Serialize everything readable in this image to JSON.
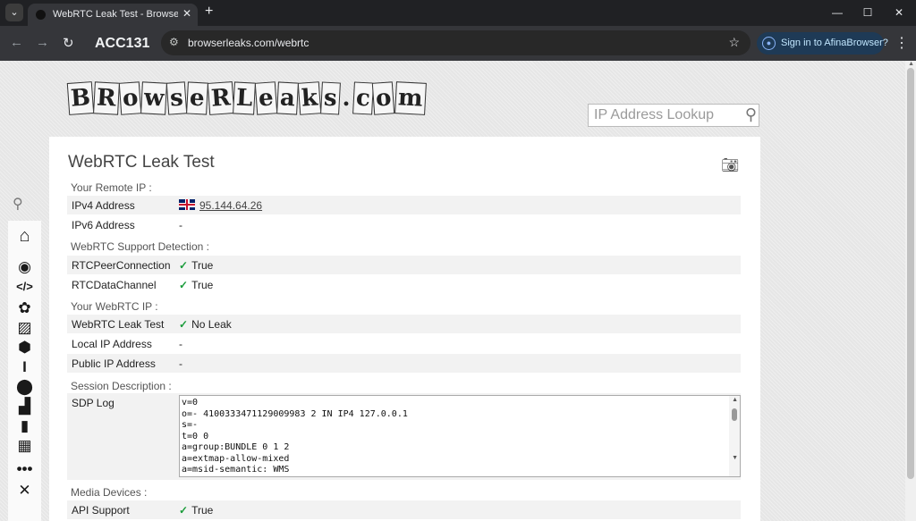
{
  "browser": {
    "tab_title": "WebRTC Leak Test - BrowserLeaks",
    "tab_close": "✕",
    "new_tab": "+",
    "profile_name": "ACC131",
    "url": "browserleaks.com/webrtc",
    "signin_label": "Sign in to AfinaBrowser?"
  },
  "site": {
    "logo_tiles": [
      "B",
      "R",
      "o",
      "w",
      "s",
      "e",
      "R",
      "L",
      "e",
      "a",
      "k",
      "s",
      ".",
      "c",
      "o",
      "m"
    ],
    "lookup_placeholder": "IP Address Lookup"
  },
  "panel": {
    "title": "WebRTC Leak Test",
    "sections": {
      "remote_ip": "Your Remote IP :",
      "support": "WebRTC Support Detection :",
      "webrtc_ip": "Your WebRTC IP :",
      "session": "Session Description :",
      "media": "Media Devices :"
    },
    "rows": {
      "ipv4_key": "IPv4 Address",
      "ipv4_val": "95.144.64.26",
      "ipv6_key": "IPv6 Address",
      "ipv6_val": "-",
      "peer_key": "RTCPeerConnection",
      "peer_val": "True",
      "channel_key": "RTCDataChannel",
      "channel_val": "True",
      "leak_key": "WebRTC Leak Test",
      "leak_val": "No Leak",
      "local_key": "Local IP Address",
      "local_val": "-",
      "public_key": "Public IP Address",
      "public_val": "-",
      "sdp_key": "SDP Log",
      "api_key": "API Support",
      "api_val": "True"
    },
    "sdp_log": "v=0\no=- 4100333471129009983 2 IN IP4 127.0.0.1\ns=-\nt=0 0\na=group:BUNDLE 0 1 2\na=extmap-allow-mixed\na=msid-semantic: WMS"
  },
  "icons": {
    "check": "✓",
    "camera": "camera-icon",
    "search": "search-icon"
  }
}
